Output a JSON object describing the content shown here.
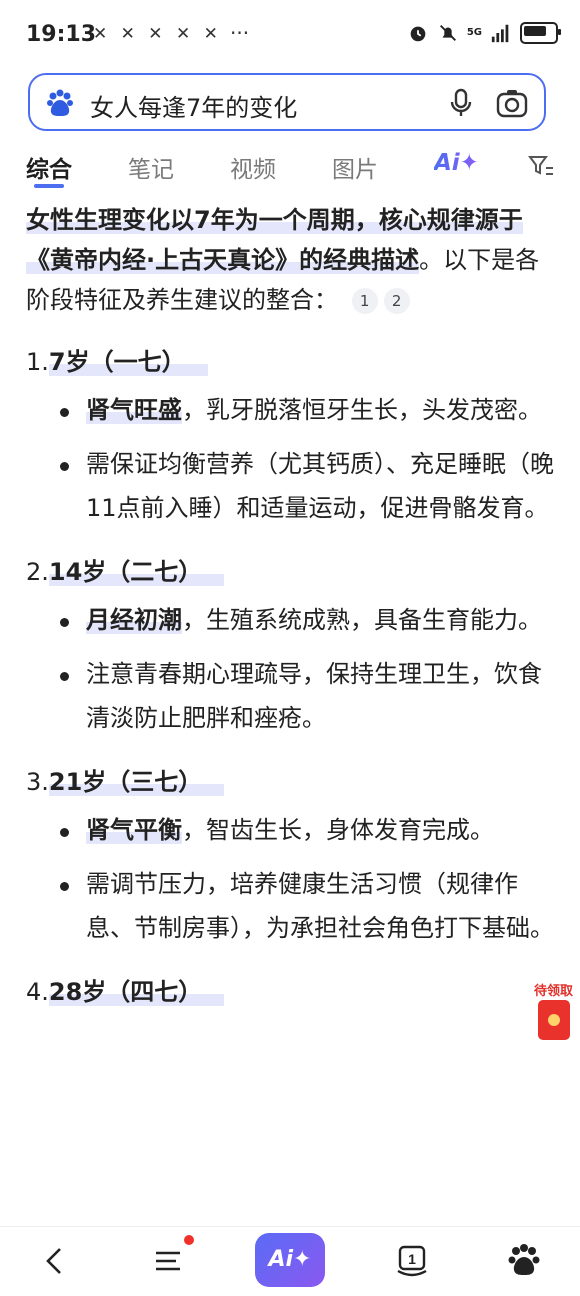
{
  "status_bar": {
    "time": "19:13",
    "notifications": "✕ ✕ ✕ ✕ ✕",
    "more": "···",
    "network": "5G"
  },
  "search": {
    "query": "女人每逢7年的变化"
  },
  "tabs": [
    {
      "label": "综合",
      "active": true
    },
    {
      "label": "笔记",
      "active": false
    },
    {
      "label": "视频",
      "active": false
    },
    {
      "label": "图片",
      "active": false
    },
    {
      "label": "Ai✦",
      "active": false
    }
  ],
  "answer": {
    "intro_part1": "女性生理变化以7年为一个周期，核心规律源于《黄帝内经·上古天真论》的经典描述",
    "intro_part2": "。以下是各阶段特征及养生建议的整合：",
    "refs": [
      "1",
      "2"
    ],
    "sections": [
      {
        "num": "1.",
        "title": "7岁（一七）",
        "items": [
          {
            "bold": "肾气旺盛",
            "text": "，乳牙脱落恒牙生长，头发茂密。"
          },
          {
            "bold": "",
            "text": "需保证均衡营养（尤其钙质）、充足睡眠（晚11点前入睡）和适量运动，促进骨骼发育。"
          }
        ]
      },
      {
        "num": "2.",
        "title": "14岁（二七）",
        "items": [
          {
            "bold": "月经初潮",
            "text": "，生殖系统成熟，具备生育能力。"
          },
          {
            "bold": "",
            "text": "注意青春期心理疏导，保持生理卫生，饮食清淡防止肥胖和痤疮。"
          }
        ]
      },
      {
        "num": "3.",
        "title": "21岁（三七）",
        "items": [
          {
            "bold": "肾气平衡",
            "text": "，智齿生长，身体发育完成。"
          },
          {
            "bold": "",
            "text": "需调节压力，培养健康生活习惯（规律作息、节制房事），为承担社会角色打下基础。"
          }
        ]
      },
      {
        "num": "4.",
        "title": "28岁（四七）",
        "items": []
      }
    ]
  },
  "red_packet": {
    "label": "待领取"
  },
  "bottom_nav": {
    "ai_label": "Ai✦",
    "badge": "1"
  }
}
